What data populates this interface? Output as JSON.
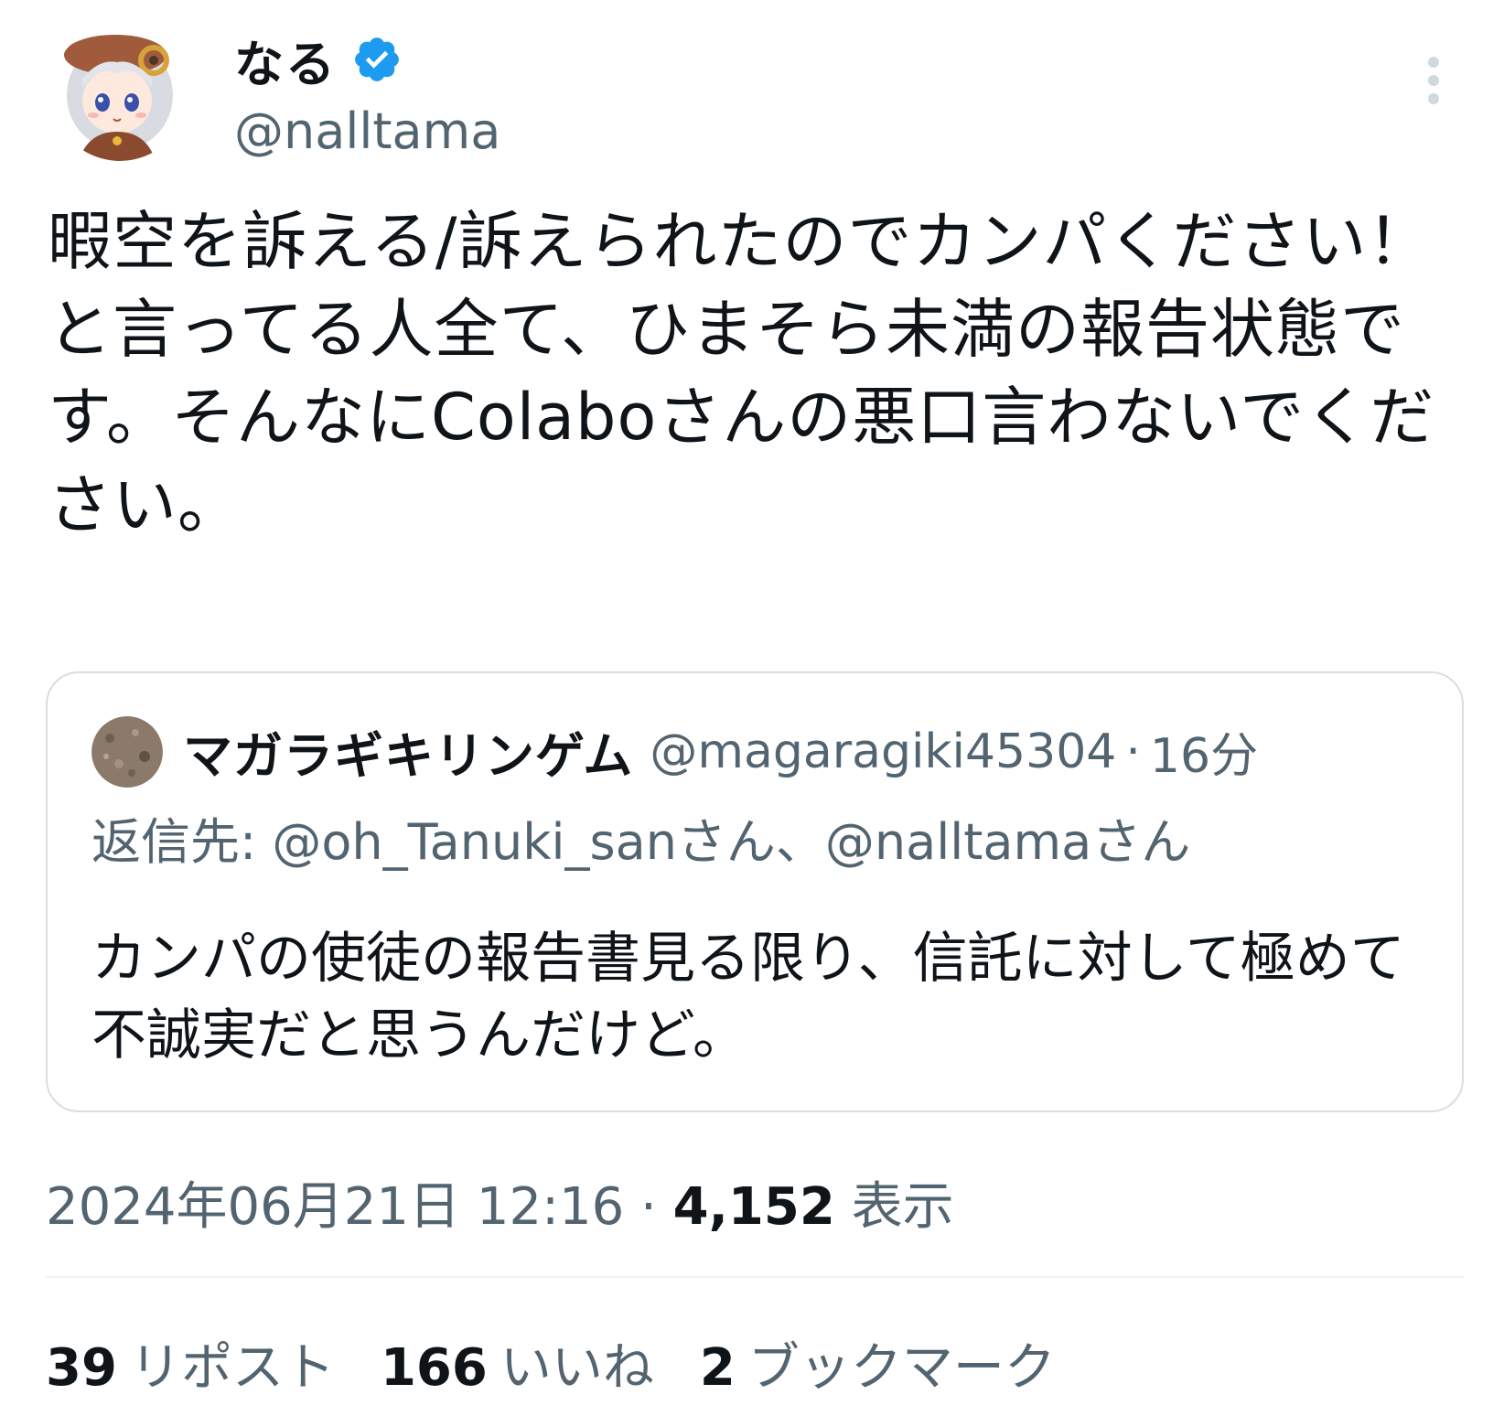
{
  "author": {
    "display_name": "なる",
    "handle": "@nalltama",
    "verified": true
  },
  "tweet": {
    "text": "暇空を訴える/訴えられたのでカンパください！\nと言ってる人全て、ひまそら未満の報告状態です。そんなにColaboさんの悪口言わないでください。"
  },
  "quoted_tweet": {
    "display_name": "マガラギキリンゲム",
    "handle": "@magaragiki45304",
    "separator": "·",
    "time": "16分",
    "reply_to": "返信先: @oh_Tanuki_sanさん、@nalltamaさん",
    "text": "カンパの使徒の報告書見る限り、信託に対して極めて不誠実だと思うんだけど。"
  },
  "meta": {
    "timestamp": "2024年06月21日 12:16",
    "separator": "·",
    "views": "4,152",
    "views_label": "表示"
  },
  "stats": {
    "reposts": "39",
    "reposts_label": "リポスト",
    "likes": "166",
    "likes_label": "いいね",
    "bookmarks": "2",
    "bookmarks_label": "ブックマーク"
  },
  "colors": {
    "text_primary": "#0f1419",
    "text_secondary": "#536471",
    "verified_blue": "#1d9bf0",
    "border": "#d8dee3"
  }
}
